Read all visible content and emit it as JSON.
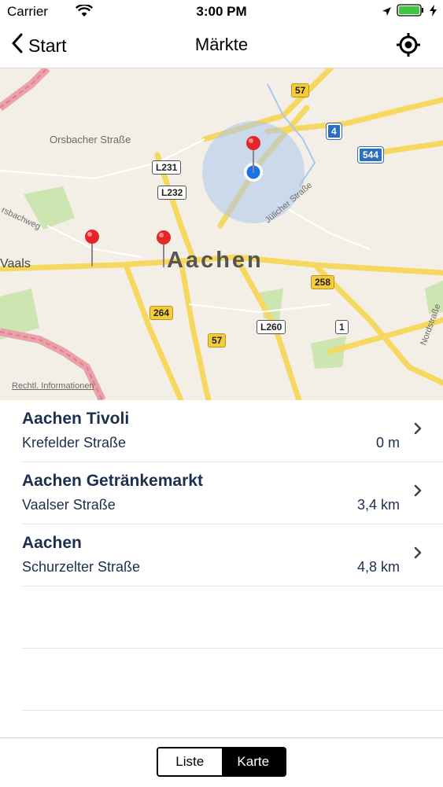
{
  "status_bar": {
    "carrier": "Carrier",
    "time": "3:00 PM"
  },
  "nav": {
    "back_label": "Start",
    "title": "Märkte"
  },
  "map": {
    "city": "Aachen",
    "place_labels": [
      "Orsbacher Straße",
      "Jülicher Straße",
      "Vaals",
      "Nordstraße",
      "rsbachweg"
    ],
    "road_shields": [
      "57",
      "4",
      "544",
      "L231",
      "L232",
      "258",
      "264",
      "L260",
      "1",
      "57"
    ],
    "legal_link": "Rechtl. Informationen"
  },
  "markets": [
    {
      "name": "Aachen Tivoli",
      "street": "Krefelder Straße",
      "distance": "0 m"
    },
    {
      "name": "Aachen Getränkemarkt",
      "street": "Vaalser Straße",
      "distance": "3,4 km"
    },
    {
      "name": "Aachen",
      "street": "Schurzelter Straße",
      "distance": "4,8 km"
    }
  ],
  "segment": {
    "list_label": "Liste",
    "map_label": "Karte",
    "selected": "Karte"
  },
  "colors": {
    "accent": "#000000",
    "text": "#1b2f4f",
    "pin": "#e4262b",
    "user_location": "#1a73e8",
    "road": "#f6d860",
    "border_road": "#e57b86"
  }
}
